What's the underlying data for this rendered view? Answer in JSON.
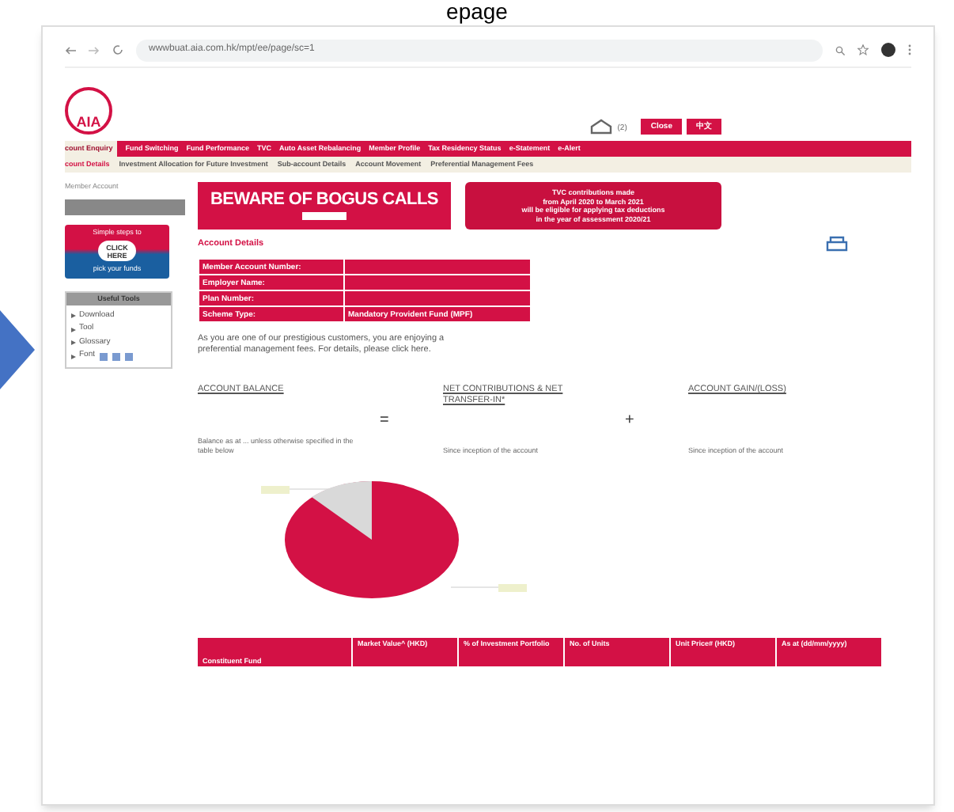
{
  "slide_title": "epage",
  "browser": {
    "url": "wwwbuat.aia.com.hk/mpt/ee/page/sc=1"
  },
  "header": {
    "logo": "AIA",
    "inbox_count": "(2)",
    "buttons": [
      "Close",
      "中文"
    ]
  },
  "main_nav": [
    {
      "label": "count Enquiry",
      "selected": true
    },
    {
      "label": "Fund Switching",
      "selected": false
    },
    {
      "label": "Fund Performance",
      "selected": false
    },
    {
      "label": "TVC",
      "selected": false
    },
    {
      "label": "Auto Asset Rebalancing",
      "selected": false
    },
    {
      "label": "Member Profile",
      "selected": false
    },
    {
      "label": "Tax Residency Status",
      "selected": false
    },
    {
      "label": "e-Statement",
      "selected": false
    },
    {
      "label": "e-Alert",
      "selected": false
    }
  ],
  "sub_nav": [
    {
      "label": "count Details",
      "selected": true
    },
    {
      "label": "Investment Allocation for Future Investment",
      "selected": false
    },
    {
      "label": "Sub-account Details",
      "selected": false
    },
    {
      "label": "Account Movement",
      "selected": false
    },
    {
      "label": "Preferential Management Fees",
      "selected": false
    }
  ],
  "sidebar": {
    "member_label": "Member Account",
    "promo": {
      "top": "Simple steps to",
      "badge": "CLICK HERE",
      "bottom": "pick your funds"
    },
    "tools_title": "Useful Tools",
    "tools": [
      "Download",
      "Tool",
      "Glossary",
      "Font"
    ]
  },
  "banners": {
    "bogus": "BEWARE OF BOGUS CALLS",
    "tvc": [
      "TVC contributions made",
      "from April 2020 to March 2021",
      "will be eligible for applying tax deductions",
      "in the year of assessment 2020/21"
    ]
  },
  "account_details": {
    "title": "Account Details",
    "rows": [
      {
        "label": "Member Account Number:",
        "value": ""
      },
      {
        "label": "Employer Name:",
        "value": ""
      },
      {
        "label": "Plan Number:",
        "value": ""
      },
      {
        "label": "Scheme Type:",
        "value": "Mandatory Provident Fund (MPF)"
      }
    ]
  },
  "notice": "As you are one of our prestigious customers, you are enjoying a preferential management fees. For details, please click here.",
  "summary": {
    "columns": [
      {
        "title": "ACCOUNT BALANCE",
        "note": "Balance as at ... unless otherwise specified in the table below"
      },
      {
        "title": "NET CONTRIBUTIONS & NET TRANSFER-IN*",
        "note": "Since inception of the account"
      },
      {
        "title": "ACCOUNT GAIN/(LOSS)",
        "note": "Since inception of the account"
      }
    ],
    "operators": [
      "=",
      "+"
    ]
  },
  "fund_table": {
    "columns": [
      "Constituent Fund",
      "Market Value^ (HKD)",
      "% of Investment Portfolio",
      "No. of Units",
      "Unit Price# (HKD)",
      "As at (dd/mm/yyyy)"
    ]
  }
}
